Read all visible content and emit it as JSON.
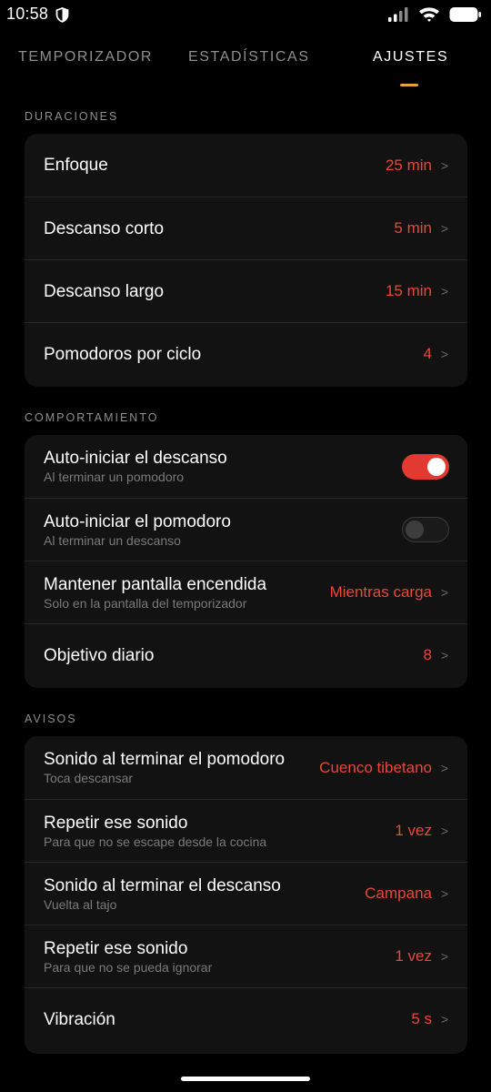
{
  "status": {
    "time": "10:58"
  },
  "tabs": [
    {
      "label": "TEMPORIZADOR"
    },
    {
      "label": "ESTADÍSTICAS"
    },
    {
      "label": "AJUSTES"
    }
  ],
  "sections": {
    "durations": {
      "title": "DURACIONES",
      "rows": [
        {
          "label": "Enfoque",
          "value": "25 min"
        },
        {
          "label": "Descanso corto",
          "value": "5 min"
        },
        {
          "label": "Descanso largo",
          "value": "15 min"
        },
        {
          "label": "Pomodoros por ciclo",
          "value": "4"
        }
      ]
    },
    "behavior": {
      "title": "COMPORTAMIENTO",
      "rows": [
        {
          "label": "Auto-iniciar el descanso",
          "sub": "Al terminar un pomodoro",
          "toggle": true
        },
        {
          "label": "Auto-iniciar el pomodoro",
          "sub": "Al terminar un descanso",
          "toggle": false
        },
        {
          "label": "Mantener pantalla encendida",
          "sub": "Solo en la pantalla del temporizador",
          "value": "Mientras carga"
        },
        {
          "label": "Objetivo diario",
          "value": "8"
        }
      ]
    },
    "alerts": {
      "title": "AVISOS",
      "rows": [
        {
          "label": "Sonido al terminar el pomodoro",
          "sub": "Toca descansar",
          "value": "Cuenco tibetano"
        },
        {
          "label": "Repetir ese sonido",
          "sub": "Para que no se escape desde la cocina",
          "value": "1 vez"
        },
        {
          "label": "Sonido al terminar el descanso",
          "sub": "Vuelta al tajo",
          "value": "Campana"
        },
        {
          "label": "Repetir ese sonido",
          "sub": "Para que no se pueda ignorar",
          "value": "1 vez"
        },
        {
          "label": "Vibración",
          "value": "5 s"
        }
      ]
    }
  },
  "chevron": ">",
  "colors": {
    "accent": "#e8473a",
    "tab_indicator": "#e8a23a",
    "toggle_on": "#e23a30",
    "background": "#000000",
    "card": "#121212"
  }
}
